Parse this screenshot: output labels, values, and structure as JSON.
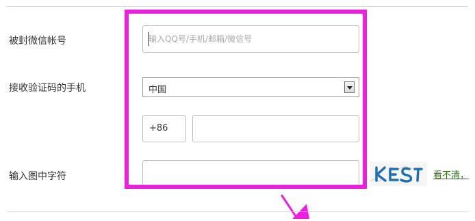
{
  "form": {
    "account_label": "被封微信帐号",
    "account_placeholder": "输入QQ号/手机/邮箱/微信号",
    "phone_label": "接收验证码的手机",
    "country_selected": "中国",
    "country_code": "+86",
    "phone_value": "",
    "captcha_label": "输入图中字符",
    "captcha_value": "",
    "captcha_text": "KES",
    "refresh_link": "看不清，"
  },
  "colors": {
    "highlight": "#ee20e0",
    "link": "#2c7a12",
    "captcha": "#1f6fb5"
  }
}
